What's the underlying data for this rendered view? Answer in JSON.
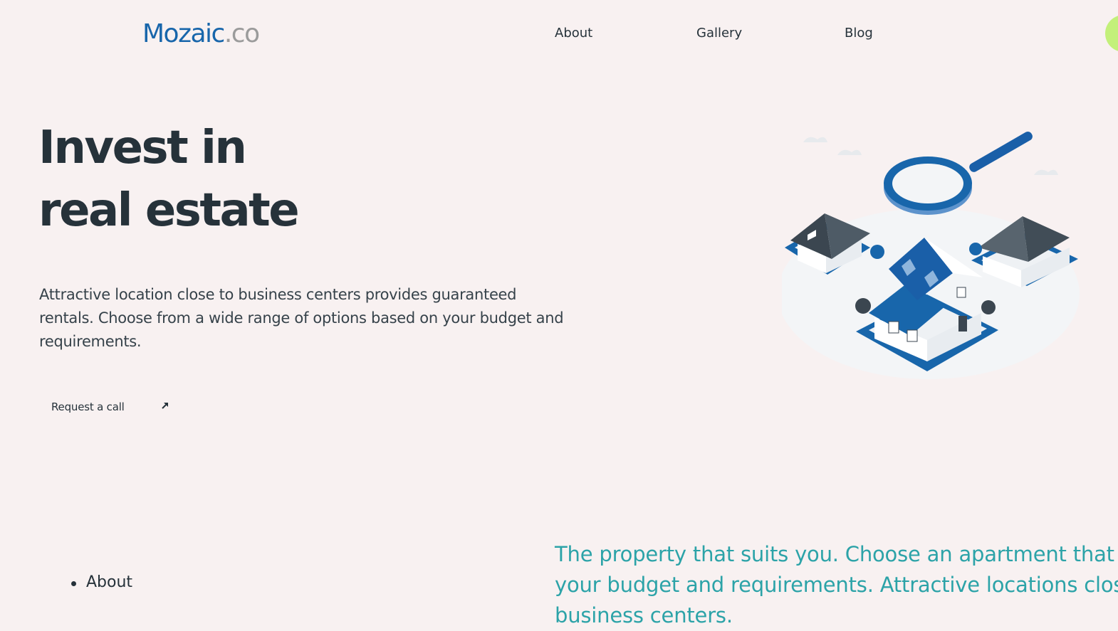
{
  "header": {
    "logo": {
      "brand": "Mozaic",
      "tld": ".co"
    },
    "nav": [
      {
        "label": "About"
      },
      {
        "label": "Gallery"
      },
      {
        "label": "Blog"
      }
    ]
  },
  "hero": {
    "title_line1": "Invest in",
    "title_line2": "real estate",
    "description": "Attractive location close to business centers provides guaranteed rentals. Choose from a wide range of options based on your budget and requirements.",
    "cta_label": "Request a call",
    "cta_icon": "arrow-up-right-icon",
    "illustration": "houses-magnifier-illustration"
  },
  "footer_links": [
    {
      "label": "About"
    }
  ],
  "tagline": "The property that suits you. Choose an apartment that suits your budget and requirements. Attractive locations close to business centers.",
  "colors": {
    "background": "#f8f1f1",
    "brand_blue": "#1866ab",
    "text_dark": "#26323a",
    "accent_teal": "#2ca3a8",
    "accent_green": "#c3f07a"
  }
}
